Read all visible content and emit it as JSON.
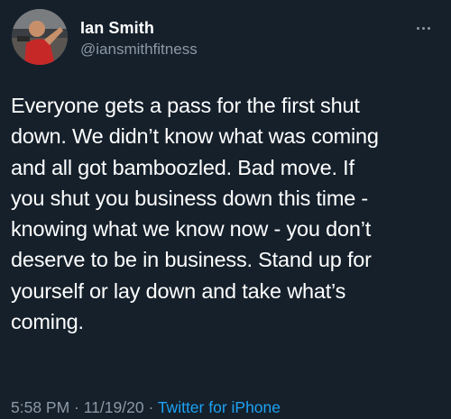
{
  "author": {
    "display_name": "Ian Smith",
    "handle": "@iansmithfitness",
    "avatar_icon": "profile-photo"
  },
  "tweet": {
    "text_lines": [
      "Everyone gets a pass for the first shut",
      "down. We didn’t know what was coming",
      "and all got bamboozled. Bad move. If",
      "you shut you business down this time -",
      "knowing what we know now - you don’t",
      "deserve to be in business. Stand up for",
      "yourself or lay down and take what’s",
      "coming."
    ]
  },
  "meta": {
    "time": "5:58 PM",
    "separator": " · ",
    "date": "11/19/20",
    "source": "Twitter for iPhone"
  },
  "menu": {
    "icon": "more-icon"
  },
  "colors": {
    "background": "#15202b",
    "primary_text": "#ffffff",
    "secondary_text": "#8b98a5",
    "link": "#1da1f2"
  }
}
